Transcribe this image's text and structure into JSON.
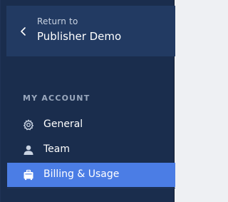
{
  "back": {
    "return_label": "Return to",
    "project_name": "Publisher Demo"
  },
  "section": {
    "title": "MY ACCOUNT"
  },
  "nav": {
    "items": [
      {
        "label": "General",
        "icon": "gear-icon",
        "active": false
      },
      {
        "label": "Team",
        "icon": "user-icon",
        "active": false
      },
      {
        "label": "Billing & Usage",
        "icon": "billing-icon",
        "active": true
      }
    ]
  },
  "colors": {
    "sidebar_bg": "#1a2d4d",
    "header_bg": "#223a62",
    "active_bg": "#4b7de5",
    "section_title": "#9aa8bd"
  }
}
